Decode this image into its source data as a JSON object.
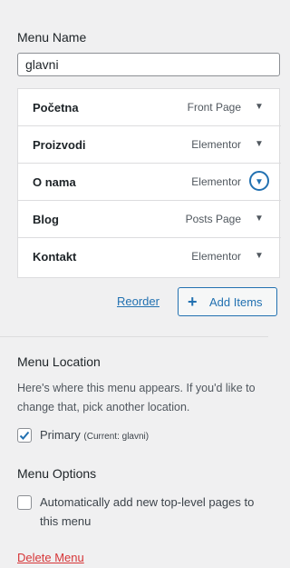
{
  "menu_name": {
    "label": "Menu Name",
    "value": "glavni"
  },
  "menu_items": [
    {
      "title": "Početna",
      "type": "Front Page"
    },
    {
      "title": "Proizvodi",
      "type": "Elementor"
    },
    {
      "title": "O nama",
      "type": "Elementor"
    },
    {
      "title": "Blog",
      "type": "Posts Page"
    },
    {
      "title": "Kontakt",
      "type": "Elementor"
    }
  ],
  "actions": {
    "reorder_label": "Reorder",
    "add_items_label": "Add Items",
    "add_icon": "plus-icon"
  },
  "menu_location": {
    "heading": "Menu Location",
    "description_line1": "Here's where this menu appears. If you'd like to",
    "description_line2": "change that, pick another location.",
    "primary_label": "Primary",
    "primary_current": "(Current: glavni)",
    "primary_checked": true
  },
  "menu_options": {
    "heading": "Menu Options",
    "auto_add_line1": "Automatically add new top-level pages to",
    "auto_add_line2": "this menu",
    "auto_add_checked": false
  },
  "delete_label": "Delete Menu",
  "colors": {
    "accent": "#2271b1",
    "danger": "#d63638",
    "background": "#f0f0f1"
  }
}
